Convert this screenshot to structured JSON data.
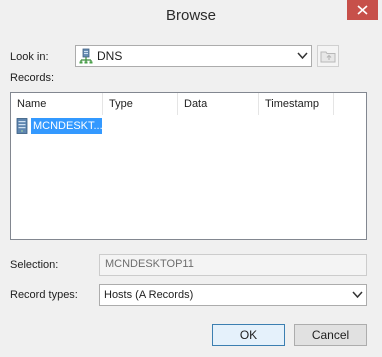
{
  "window": {
    "title": "Browse"
  },
  "look_in": {
    "label": "Look in:",
    "value": "DNS",
    "icon": "dns-server-icon"
  },
  "records": {
    "label": "Records:",
    "columns": [
      "Name",
      "Type",
      "Data",
      "Timestamp"
    ],
    "rows": [
      {
        "name": "MCNDESKT...",
        "type": "",
        "data": "",
        "timestamp": ""
      }
    ]
  },
  "selection": {
    "label": "Selection:",
    "value": "MCNDESKTOP11"
  },
  "record_types": {
    "label": "Record types:",
    "value": "Hosts (A Records)"
  },
  "buttons": {
    "ok": "OK",
    "cancel": "Cancel"
  },
  "colors": {
    "close": "#c7504a",
    "selection": "#3399ff",
    "ok_border": "#3c7fb1"
  }
}
